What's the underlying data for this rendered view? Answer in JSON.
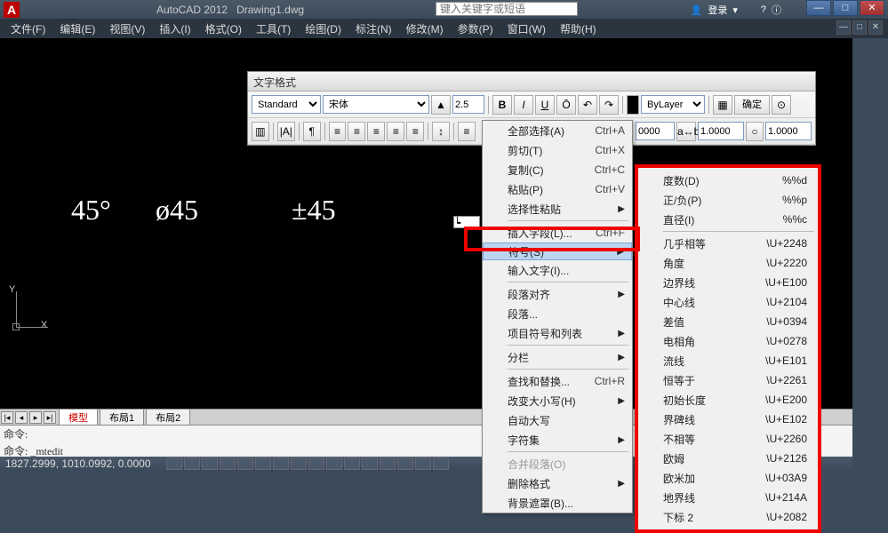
{
  "title": {
    "app": "AutoCAD 2012",
    "file": "Drawing1.dwg"
  },
  "search": {
    "placeholder": "键入关键字或短语"
  },
  "login": {
    "label": "登录"
  },
  "menubar": [
    "文件(F)",
    "编辑(E)",
    "视图(V)",
    "插入(I)",
    "格式(O)",
    "工具(T)",
    "绘图(D)",
    "标注(N)",
    "修改(M)",
    "参数(P)",
    "窗口(W)",
    "帮助(H)"
  ],
  "text_toolbar": {
    "title": "文字格式",
    "style": "Standard",
    "font": "宋体",
    "height": "2.5",
    "layer": "ByLayer",
    "ok": "确定",
    "ab": "1.0000",
    "o": "1.0000"
  },
  "canvas": {
    "t1": "45°",
    "t2": "ø45",
    "t3": "±45"
  },
  "tabs": {
    "model": "模型",
    "layout1": "布局1",
    "layout2": "布局2"
  },
  "cmd": {
    "l1": "命令:",
    "l2": "命令: _mtedit"
  },
  "status": {
    "coords": "1827.2999, 1010.0992, 0.0000"
  },
  "context": [
    {
      "label": "全部选择(A)",
      "sc": "Ctrl+A"
    },
    {
      "label": "剪切(T)",
      "sc": "Ctrl+X"
    },
    {
      "label": "复制(C)",
      "sc": "Ctrl+C"
    },
    {
      "label": "粘贴(P)",
      "sc": "Ctrl+V"
    },
    {
      "label": "选择性粘贴",
      "arrow": true
    },
    {
      "sep": true
    },
    {
      "label": "插入字段(L)...",
      "sc": "Ctrl+F"
    },
    {
      "label": "符号(S)",
      "arrow": true,
      "hl": true
    },
    {
      "label": "输入文字(I)..."
    },
    {
      "sep": true
    },
    {
      "label": "段落对齐",
      "arrow": true
    },
    {
      "label": "段落..."
    },
    {
      "label": "项目符号和列表",
      "arrow": true
    },
    {
      "sep": true
    },
    {
      "label": "分栏",
      "arrow": true
    },
    {
      "sep": true
    },
    {
      "label": "查找和替换...",
      "sc": "Ctrl+R"
    },
    {
      "label": "改变大小写(H)",
      "arrow": true
    },
    {
      "label": "自动大写"
    },
    {
      "label": "字符集",
      "arrow": true
    },
    {
      "sep": true
    },
    {
      "label": "合并段落(O)",
      "disabled": true
    },
    {
      "label": "删除格式",
      "arrow": true
    },
    {
      "label": "背景遮罩(B)..."
    }
  ],
  "symbols": [
    {
      "label": "度数(D)",
      "code": "%%d"
    },
    {
      "label": "正/负(P)",
      "code": "%%p"
    },
    {
      "label": "直径(I)",
      "code": "%%c"
    },
    {
      "sep": true
    },
    {
      "label": "几乎相等",
      "code": "\\U+2248"
    },
    {
      "label": "角度",
      "code": "\\U+2220"
    },
    {
      "label": "边界线",
      "code": "\\U+E100"
    },
    {
      "label": "中心线",
      "code": "\\U+2104"
    },
    {
      "label": "差值",
      "code": "\\U+0394"
    },
    {
      "label": "电相角",
      "code": "\\U+0278"
    },
    {
      "label": "流线",
      "code": "\\U+E101"
    },
    {
      "label": "恒等于",
      "code": "\\U+2261"
    },
    {
      "label": "初始长度",
      "code": "\\U+E200"
    },
    {
      "label": "界碑线",
      "code": "\\U+E102"
    },
    {
      "label": "不相等",
      "code": "\\U+2260"
    },
    {
      "label": "欧姆",
      "code": "\\U+2126"
    },
    {
      "label": "欧米加",
      "code": "\\U+03A9"
    },
    {
      "label": "地界线",
      "code": "\\U+214A"
    },
    {
      "label": "下标 2",
      "code": "\\U+2082"
    }
  ]
}
